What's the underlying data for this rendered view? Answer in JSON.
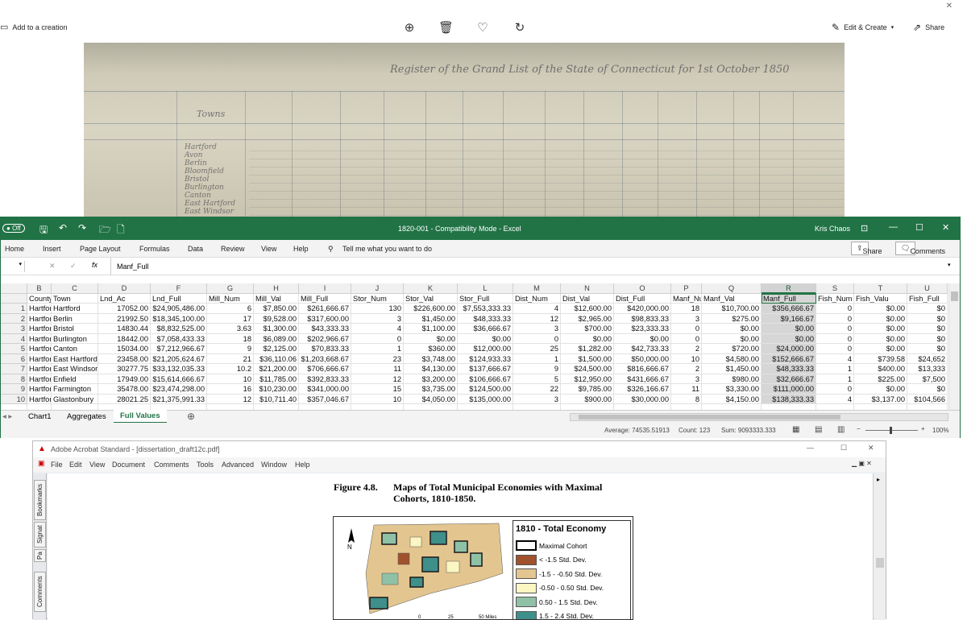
{
  "photo_viewer": {
    "add_to_creation": "Add to a creation",
    "edit_create": "Edit & Create",
    "share": "Share",
    "ledger_title": "Register of the Grand List of the State of Connecticut for 1st October 1850",
    "ledger_heading": "Towns",
    "ledger_towns": [
      "Hartford",
      "Avon",
      "Berlin",
      "Bloomfield",
      "Bristol",
      "Burlington",
      "Canton",
      "East Hartford",
      "East Windsor"
    ]
  },
  "excel": {
    "autosave": "Off",
    "title": "1820-001  -  Compatibility Mode  -  Excel",
    "user": "Kris Chaos",
    "ribbon": [
      "Home",
      "Insert",
      "Page Layout",
      "Formulas",
      "Data",
      "Review",
      "View",
      "Help"
    ],
    "tell_me": "Tell me what you want to do",
    "share_label": "Share",
    "comments_label": "Comments",
    "formula_content": "Manf_Full",
    "fx": "fx",
    "col_letters": [
      "B",
      "C",
      "D",
      "F",
      "G",
      "H",
      "I",
      "J",
      "K",
      "L",
      "M",
      "N",
      "O",
      "P",
      "Q",
      "R",
      "S",
      "T",
      "U"
    ],
    "headers": [
      "County",
      "Town",
      "Lnd_Ac",
      "Lnd_Full",
      "Mill_Num",
      "Mill_Val",
      "Mill_Full",
      "Stor_Num",
      "Stor_Val",
      "Stor_Full",
      "Dist_Num",
      "Dist_Val",
      "Dist_Full",
      "Manf_Nu",
      "Manf_Val",
      "Manf_Full",
      "Fish_Num",
      "Fish_Valu",
      "Fish_Full"
    ],
    "rows": [
      [
        "1",
        "Hartford",
        "Hartford",
        "17052.00",
        "$24,905,486.00",
        "6",
        "$7,850.00",
        "$261,666.67",
        "130",
        "$226,600.00",
        "$7,553,333.33",
        "4",
        "$12,600.00",
        "$420,000.00",
        "18",
        "$10,700.00",
        "$356,666.67",
        "0",
        "$0.00",
        "$0"
      ],
      [
        "2",
        "Hartford",
        "Berlin",
        "21992.50",
        "$18,345,100.00",
        "17",
        "$9,528.00",
        "$317,600.00",
        "3",
        "$1,450.00",
        "$48,333.33",
        "12",
        "$2,965.00",
        "$98,833.33",
        "3",
        "$275.00",
        "$9,166.67",
        "0",
        "$0.00",
        "$0"
      ],
      [
        "3",
        "Hartford",
        "Bristol",
        "14830.44",
        "$8,832,525.00",
        "3.63",
        "$1,300.00",
        "$43,333.33",
        "4",
        "$1,100.00",
        "$36,666.67",
        "3",
        "$700.00",
        "$23,333.33",
        "0",
        "$0.00",
        "$0.00",
        "0",
        "$0.00",
        "$0"
      ],
      [
        "4",
        "Hartford",
        "Burlington",
        "18442.00",
        "$7,058,433.33",
        "18",
        "$6,089.00",
        "$202,966.67",
        "0",
        "$0.00",
        "$0.00",
        "0",
        "$0.00",
        "$0.00",
        "0",
        "$0.00",
        "$0.00",
        "0",
        "$0.00",
        "$0"
      ],
      [
        "5",
        "Hartford",
        "Canton",
        "15034.00",
        "$7,212,966.67",
        "9",
        "$2,125.00",
        "$70,833.33",
        "1",
        "$360.00",
        "$12,000.00",
        "25",
        "$1,282.00",
        "$42,733.33",
        "2",
        "$720.00",
        "$24,000.00",
        "0",
        "$0.00",
        "$0"
      ],
      [
        "6",
        "Hartford",
        "East Hartford",
        "23458.00",
        "$21,205,624.67",
        "21",
        "$36,110.06",
        "$1,203,668.67",
        "23",
        "$3,748.00",
        "$124,933.33",
        "1",
        "$1,500.00",
        "$50,000.00",
        "10",
        "$4,580.00",
        "$152,666.67",
        "4",
        "$739.58",
        "$24,652"
      ],
      [
        "7",
        "Hartford",
        "East Windsor",
        "30277.75",
        "$33,132,035.33",
        "10.2",
        "$21,200.00",
        "$706,666.67",
        "11",
        "$4,130.00",
        "$137,666.67",
        "9",
        "$24,500.00",
        "$816,666.67",
        "2",
        "$1,450.00",
        "$48,333.33",
        "1",
        "$400.00",
        "$13,333"
      ],
      [
        "8",
        "Hartford",
        "Enfield",
        "17949.00",
        "$15,614,666.67",
        "10",
        "$11,785.00",
        "$392,833.33",
        "12",
        "$3,200.00",
        "$106,666.67",
        "5",
        "$12,950.00",
        "$431,666.67",
        "3",
        "$980.00",
        "$32,666.67",
        "1",
        "$225.00",
        "$7,500"
      ],
      [
        "9",
        "Hartford",
        "Farmington",
        "35478.00",
        "$23,474,298.00",
        "16",
        "$10,230.00",
        "$341,000.00",
        "15",
        "$3,735.00",
        "$124,500.00",
        "22",
        "$9,785.00",
        "$326,166.67",
        "11",
        "$3,330.00",
        "$111,000.00",
        "0",
        "$0.00",
        "$0"
      ],
      [
        "10",
        "Hartford",
        "Glastonbury",
        "28021.25",
        "$21,375,991.33",
        "12",
        "$10,711.40",
        "$357,046.67",
        "10",
        "$4,050.00",
        "$135,000.00",
        "3",
        "$900.00",
        "$30,000.00",
        "8",
        "$4,150.00",
        "$138,333.33",
        "4",
        "$3,137.00",
        "$104,566"
      ]
    ],
    "tabs": [
      "Chart1",
      "Aggregates",
      "Full Values"
    ],
    "status_average": "Average: 74535.51913",
    "status_count": "Count: 123",
    "status_sum": "Sum: 9093333.333",
    "zoom": "100%"
  },
  "acrobat": {
    "title": "Adobe Acrobat Standard - [dissertation_draft12c.pdf]",
    "menu": [
      "File",
      "Edit",
      "View",
      "Document",
      "Comments",
      "Tools",
      "Advanced",
      "Window",
      "Help"
    ],
    "side_tabs": [
      "Bookmarks",
      "Signat",
      "Pa",
      "Comments"
    ],
    "figure_num": "Figure 4.8.",
    "figure_title_1": "Maps of Total Municipal Economies with Maximal",
    "figure_title_2": "Cohorts, 1810-1850.",
    "legend_title": "1810 - Total Economy",
    "legend_items": [
      {
        "label": "Maximal Cohort",
        "color": "#ffffff"
      },
      {
        "label": "< -1.5 Std. Dev.",
        "color": "#a0522d"
      },
      {
        "label": "-1.5 - -0.50 Std. Dev.",
        "color": "#e3c58f"
      },
      {
        "label": "-0.50 - 0.50 Std. Dev.",
        "color": "#fbf6c2"
      },
      {
        "label": "0.50 - 1.5 Std. Dev.",
        "color": "#8fc1a6"
      },
      {
        "label": "1.5 - 2.4 Std. Dev.",
        "color": "#3f8f8a"
      }
    ],
    "north": "N",
    "scale_labels": [
      "0",
      "25",
      "50 Miles"
    ]
  }
}
